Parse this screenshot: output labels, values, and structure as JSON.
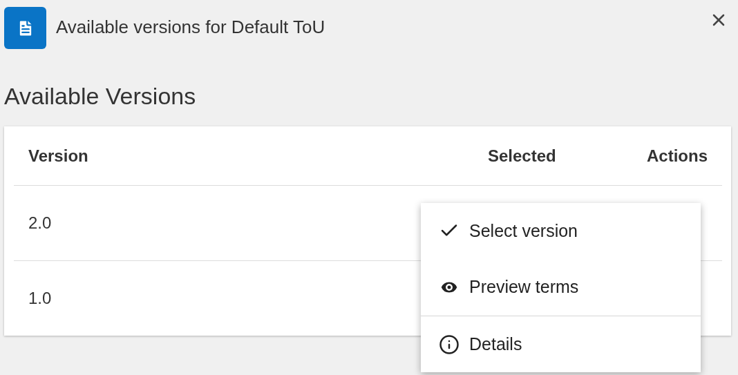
{
  "dialog": {
    "title": "Available versions for Default ToU",
    "heading": "Available Versions"
  },
  "table": {
    "columns": [
      "Version",
      "Selected",
      "Actions"
    ],
    "rows": [
      {
        "version": "2.0"
      },
      {
        "version": "1.0"
      }
    ]
  },
  "menu": {
    "items": [
      {
        "kind": "check",
        "label": "Select version",
        "divider_before": false
      },
      {
        "kind": "eye",
        "label": "Preview terms",
        "divider_before": false
      },
      {
        "kind": "info",
        "label": "Details",
        "divider_before": true
      }
    ]
  }
}
